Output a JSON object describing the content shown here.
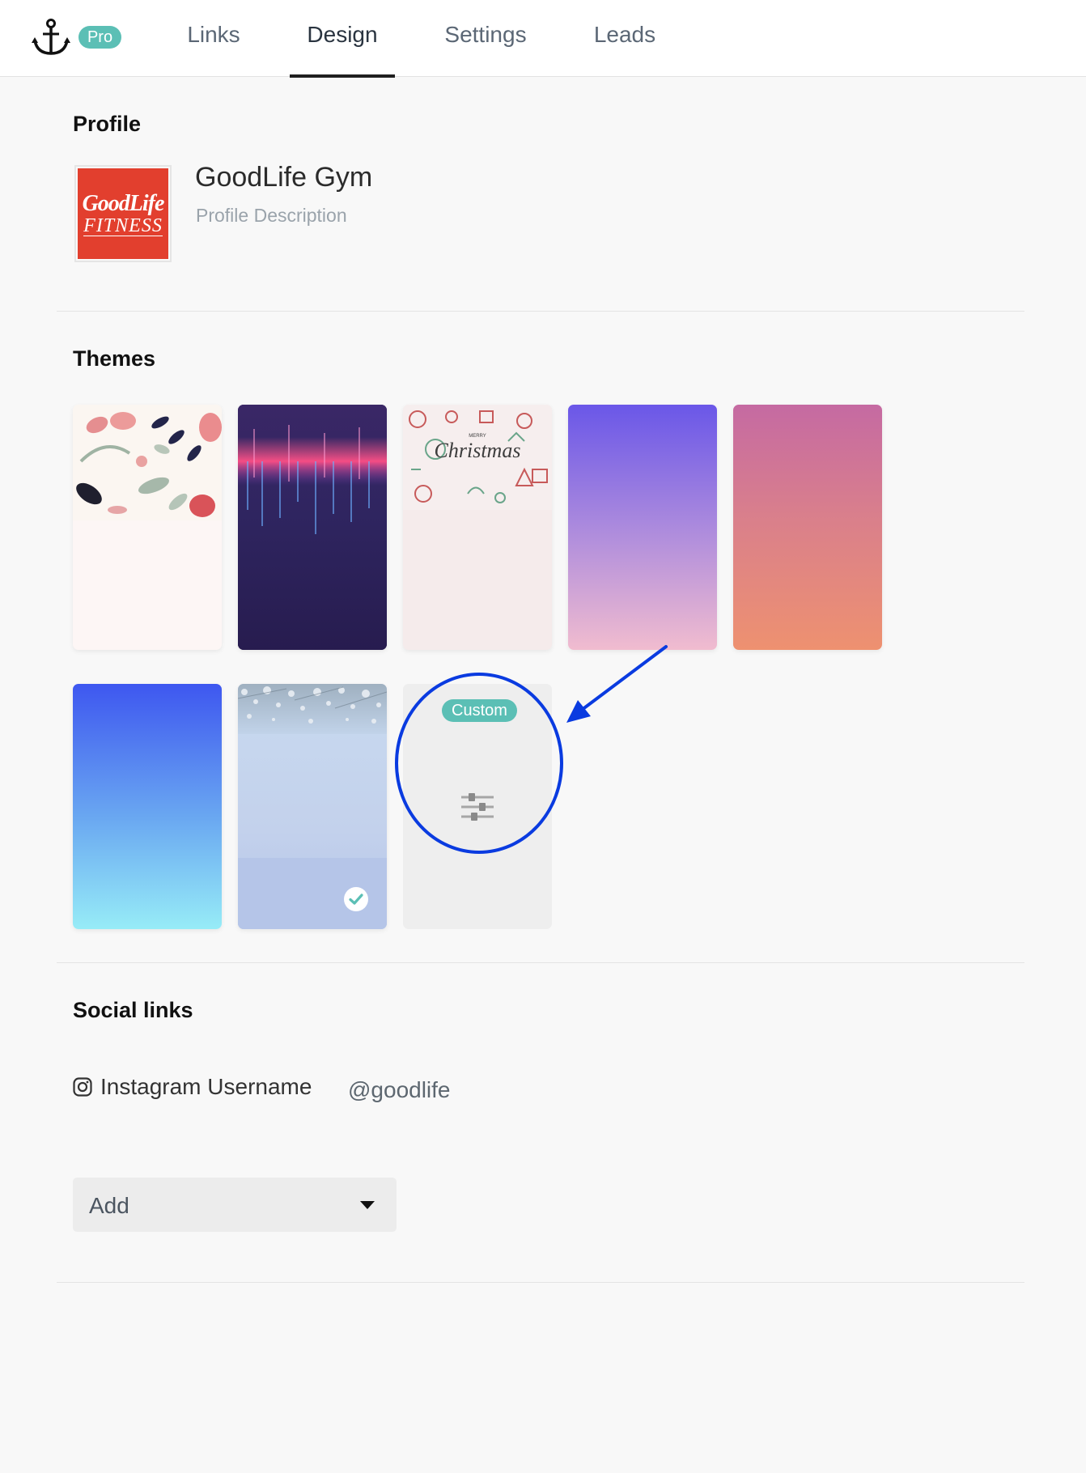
{
  "nav": {
    "logo_icon": "anchor-icon",
    "pro_badge": "Pro",
    "tabs": [
      {
        "label": "Links",
        "active": false
      },
      {
        "label": "Design",
        "active": true
      },
      {
        "label": "Settings",
        "active": false
      },
      {
        "label": "Leads",
        "active": false
      }
    ]
  },
  "profile": {
    "title": "Profile",
    "logo_text_1": "GoodLife",
    "logo_text_2": "FITNESS",
    "name": "GoodLife Gym",
    "description_placeholder": "Profile Description"
  },
  "themes": {
    "title": "Themes",
    "items": [
      {
        "id": "floral",
        "selected": false
      },
      {
        "id": "neon",
        "selected": false
      },
      {
        "id": "christmas",
        "selected": false,
        "image_text": "MERRY Christmas"
      },
      {
        "id": "purple-gradient",
        "selected": false
      },
      {
        "id": "sunset-gradient",
        "selected": false
      },
      {
        "id": "blue-gradient",
        "selected": false
      },
      {
        "id": "winter",
        "selected": true
      },
      {
        "id": "custom",
        "selected": false
      }
    ],
    "custom_label": "Custom",
    "custom_icon": "sliders-icon",
    "selected_icon": "check-circle-icon"
  },
  "social": {
    "title": "Social links",
    "instagram_icon": "instagram-icon",
    "instagram_label": "Instagram Username",
    "instagram_value": "@goodlife",
    "add_select_value": "Add"
  },
  "colors": {
    "accent_teal": "#5bbfb5",
    "logo_red": "#e23f2e",
    "annotation_blue": "#0a3be0"
  }
}
